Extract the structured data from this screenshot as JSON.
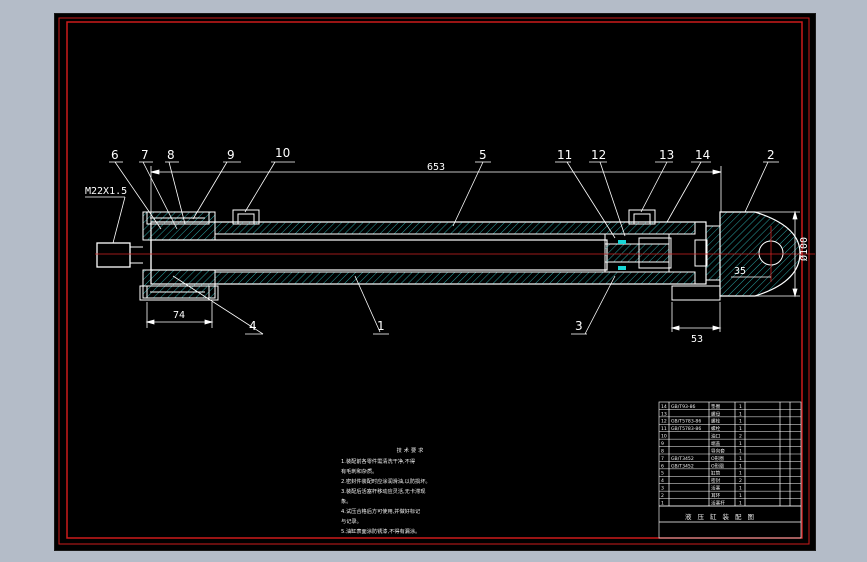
{
  "drawing": {
    "thread_label": "M22X1.5",
    "dim_total": "653",
    "dim_left": "74",
    "dim_right": "53",
    "dim_pin_offset": "35",
    "dim_diameter": "Ø100",
    "part_callouts": [
      "6",
      "7",
      "8",
      "9",
      "10",
      "5",
      "11",
      "12",
      "13",
      "14",
      "2",
      "4",
      "1",
      "3"
    ]
  },
  "tech_notes": {
    "title": "技术要求",
    "lines": [
      "1.装配前各零件需清洗干净,不得",
      "有毛刺和杂质。",
      "2.密封件装配时应涂润滑油,以防损坏。",
      "3.装配后活塞杆移动应灵活,无卡滞现",
      "象。",
      "4.试压合格后方可使用,并做好标记",
      "与记录。",
      "5.油缸表面涂防锈漆,不得有漏涂。"
    ]
  },
  "title_block": {
    "title_row": "液压缸装配图",
    "rows": [
      [
        "14",
        "GB/T93-86",
        "垫圈",
        "1",
        "",
        "",
        ""
      ],
      [
        "13",
        "",
        "螺母",
        "1",
        "",
        "",
        ""
      ],
      [
        "12",
        "GB/T5783-86",
        "螺栓",
        "1",
        "",
        "",
        ""
      ],
      [
        "11",
        "GB/T5783-86",
        "螺栓",
        "1",
        "",
        "",
        ""
      ],
      [
        "10",
        "",
        "油口",
        "2",
        "",
        "",
        ""
      ],
      [
        "9",
        "",
        "端盖",
        "1",
        "",
        "",
        ""
      ],
      [
        "8",
        "",
        "导向套",
        "1",
        "",
        "",
        ""
      ],
      [
        "7",
        "GB/T3452",
        "O形圈",
        "1",
        "",
        "",
        ""
      ],
      [
        "6",
        "GB/T3452",
        "O形圈",
        "1",
        "",
        "",
        ""
      ],
      [
        "5",
        "",
        "缸筒",
        "1",
        "",
        "",
        ""
      ],
      [
        "4",
        "",
        "密封",
        "2",
        "",
        "",
        ""
      ],
      [
        "3",
        "",
        "活塞",
        "1",
        "",
        "",
        ""
      ],
      [
        "2",
        "",
        "耳环",
        "1",
        "",
        "",
        ""
      ],
      [
        "1",
        "",
        "活塞杆",
        "1",
        "",
        "",
        ""
      ]
    ]
  }
}
